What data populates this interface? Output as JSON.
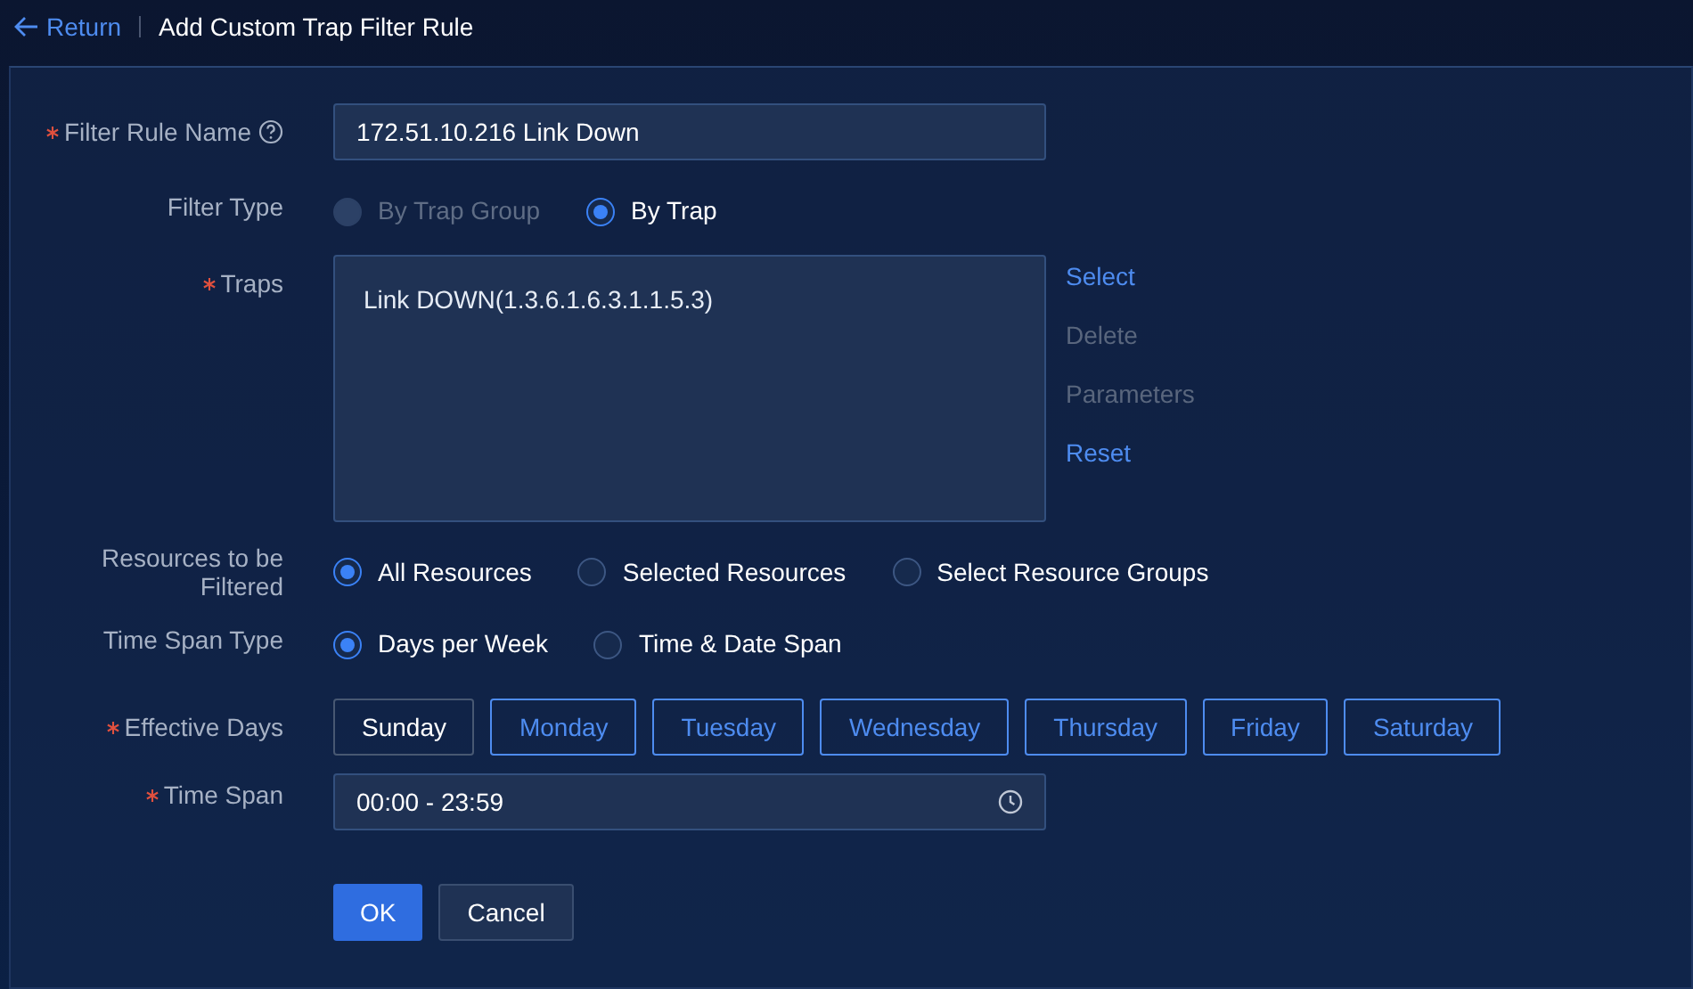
{
  "header": {
    "back_link": "Return",
    "title": "Add Custom Trap Filter Rule"
  },
  "form": {
    "rule_name": {
      "label": "Filter Rule Name",
      "required": true,
      "value": "172.51.10.216 Link Down"
    },
    "filter_type": {
      "label": "Filter Type",
      "options": [
        {
          "label": "By Trap Group",
          "selected": false,
          "disabled": true
        },
        {
          "label": "By Trap",
          "selected": true,
          "disabled": false
        }
      ]
    },
    "traps": {
      "label": "Traps",
      "required": true,
      "items": [
        "Link DOWN(1.3.6.1.6.3.1.1.5.3)"
      ],
      "actions": [
        {
          "label": "Select",
          "disabled": false
        },
        {
          "label": "Delete",
          "disabled": true
        },
        {
          "label": "Parameters",
          "disabled": true
        },
        {
          "label": "Reset",
          "disabled": false
        }
      ]
    },
    "resources": {
      "label": "Resources to be Filtered",
      "options": [
        {
          "label": "All Resources",
          "selected": true
        },
        {
          "label": "Selected Resources",
          "selected": false
        },
        {
          "label": "Select Resource Groups",
          "selected": false
        }
      ]
    },
    "time_span_type": {
      "label": "Time Span Type",
      "options": [
        {
          "label": "Days per Week",
          "selected": true
        },
        {
          "label": "Time & Date Span",
          "selected": false
        }
      ]
    },
    "effective_days": {
      "label": "Effective Days",
      "required": true,
      "days": [
        {
          "label": "Sunday",
          "selected": false
        },
        {
          "label": "Monday",
          "selected": true
        },
        {
          "label": "Tuesday",
          "selected": true
        },
        {
          "label": "Wednesday",
          "selected": true
        },
        {
          "label": "Thursday",
          "selected": true
        },
        {
          "label": "Friday",
          "selected": true
        },
        {
          "label": "Saturday",
          "selected": true
        }
      ]
    },
    "time_span": {
      "label": "Time Span",
      "required": true,
      "value": "00:00 - 23:59"
    }
  },
  "buttons": [
    {
      "label": "OK",
      "kind": "primary"
    },
    {
      "label": "Cancel",
      "kind": "secondary"
    }
  ]
}
